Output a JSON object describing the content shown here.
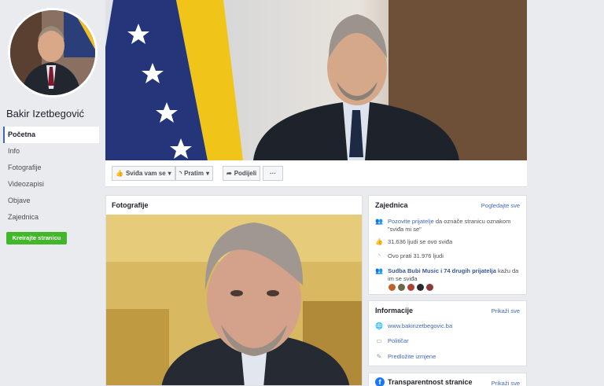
{
  "page": {
    "name": "Bakir Izetbegović"
  },
  "nav": {
    "items": [
      {
        "label": "Početna",
        "active": true
      },
      {
        "label": "Info"
      },
      {
        "label": "Fotografije"
      },
      {
        "label": "Videozapisi"
      },
      {
        "label": "Objave"
      },
      {
        "label": "Zajednica"
      }
    ],
    "create_label": "Kreirajte stranicu"
  },
  "actions": {
    "like_label": "Sviđa vam se",
    "follow_label": "Pratim",
    "share_label": "Podijeli",
    "more_label": "···"
  },
  "photos": {
    "title": "Fotografije"
  },
  "community": {
    "title": "Zajednica",
    "see_all": "Pogledajte sve",
    "invite_link": "Pozovite prijatelje",
    "invite_rest": " da označe stranicu oznakom \"sviđa mi se\"",
    "likes_text": "31.636 ljudi se ovo sviđa",
    "follows_text": "Ovo prati 31.976 ljudi",
    "friends_link": "Sudba Bubi Music i 74 drugih prijatelja",
    "friends_rest": " kažu da im se sviđa"
  },
  "info": {
    "title": "Informacije",
    "see_all": "Prikaži sve",
    "website": "www.bakirizetbegovic.ba",
    "category": "Političar",
    "suggest": "Predložite izmjene"
  },
  "transparency": {
    "title": "Transparentnost stranice",
    "see_all": "Prikaži sve"
  },
  "colors": {
    "accent": "#4267b2",
    "create_button": "#42b72a",
    "background": "#e9ebee"
  }
}
